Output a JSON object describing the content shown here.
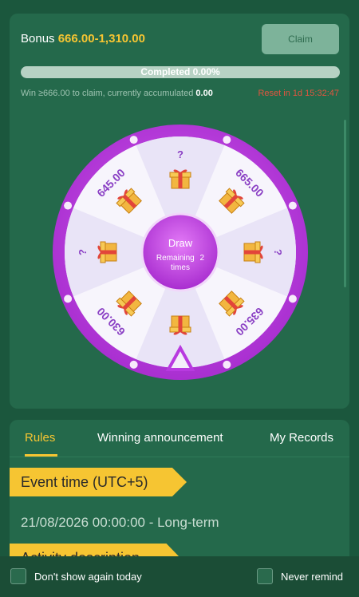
{
  "bonus": {
    "label": "Bonus",
    "range": "666.00-1,310.00",
    "claim_label": "Claim"
  },
  "progress": {
    "text": "Completed 0.00%",
    "percent": 0
  },
  "requirement": {
    "text": "Win ≥666.00 to claim, currently accumulated",
    "accumulated": "0.00",
    "reset": "Reset in 1d 15:32:47"
  },
  "wheel": {
    "draw_label": "Draw",
    "remaining_label": "Remaining",
    "remaining_count": "2",
    "times_label": "times",
    "prizes": [
      "?",
      "665.00",
      "?",
      "635.00",
      "?",
      "630.00",
      "?",
      "645.00"
    ],
    "prize_icon": "gift-box-icon"
  },
  "tabs": [
    "Rules",
    "Winning announcement",
    "My Records"
  ],
  "rules": {
    "event_time_label": "Event time (UTC+5)",
    "event_time_value": "21/08/2026 00:00:00 - Long-term",
    "activity_label": "Activity description"
  },
  "footer": {
    "dont_show_label": "Don't show again today",
    "never_remind_label": "Never remind"
  },
  "colors": {
    "accent": "#f6c532",
    "wheel_rim": "#c648e8",
    "reset": "#e2553f"
  }
}
